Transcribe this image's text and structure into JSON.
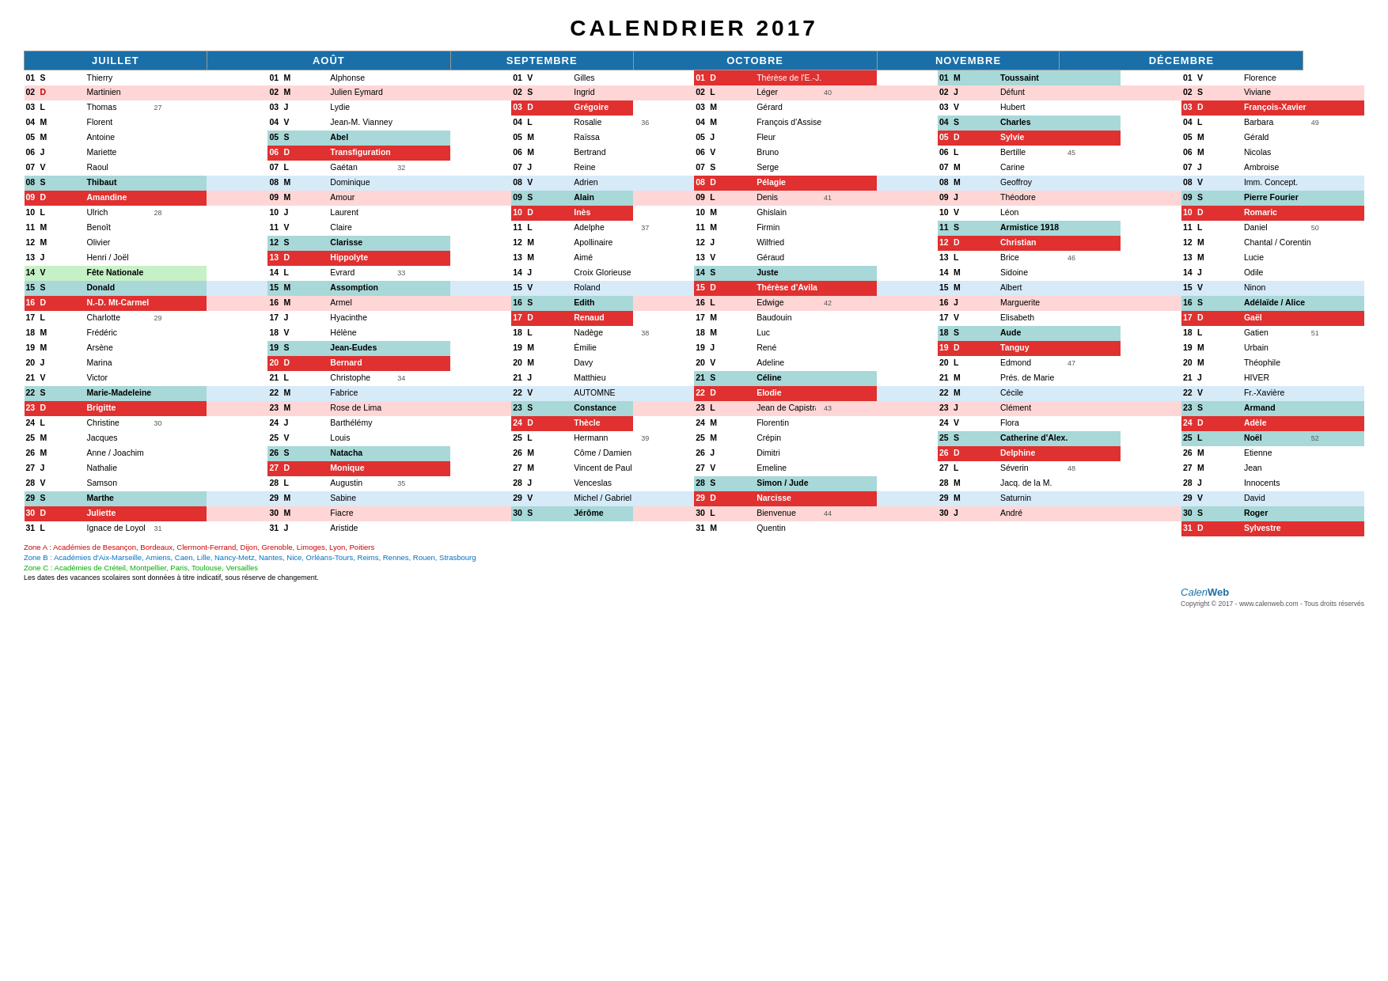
{
  "title": "CALENDRIER  2017",
  "months": [
    "JUILLET",
    "AOÛT",
    "SEPTEMBRE",
    "OCTOBRE",
    "NOVEMBRE",
    "DÉCEMBRE"
  ],
  "footer": {
    "zoneA": "Zone A : Académies de Besançon, Bordeaux, Clermont-Ferrand, Dijon, Grenoble, Limoges, Lyon, Poitiers",
    "zoneB": "Zone B : Académies d'Aix-Marseille, Amiens, Caen, Lille, Nancy-Metz, Nantes, Nice, Orléans-Tours, Reims, Rennes, Rouen, Strasbourg",
    "zoneC": "Zone C : Académies de Créteil, Montpellier, Paris, Toulouse, Versailles",
    "note": "Les dates des vacances scolaires sont données à titre indicatif, sous réserve de changement.",
    "copyright": "Copyright  ©  2017 - www.calenweb.com - Tous droits réservés",
    "logo": "CalenWeb"
  }
}
